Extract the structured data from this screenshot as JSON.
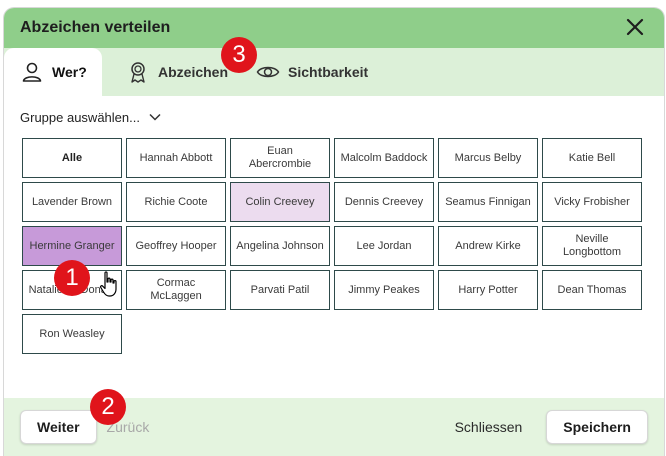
{
  "modal": {
    "title": "Abzeichen verteilen"
  },
  "tabs": [
    {
      "label": "Wer?",
      "icon": "person-icon",
      "active": true
    },
    {
      "label": "Abzeichen",
      "icon": "award-icon",
      "active": false
    },
    {
      "label": "Sichtbarkeit",
      "icon": "eye-icon",
      "active": false
    }
  ],
  "group_select": {
    "label": "Gruppe auswählen..."
  },
  "students": [
    {
      "name": "Alle",
      "state": "bold"
    },
    {
      "name": "Hannah Abbott",
      "state": "normal"
    },
    {
      "name": "Euan Abercrombie",
      "state": "normal"
    },
    {
      "name": "Malcolm Baddock",
      "state": "normal"
    },
    {
      "name": "Marcus Belby",
      "state": "normal"
    },
    {
      "name": "Katie Bell",
      "state": "normal"
    },
    {
      "name": "Lavender Brown",
      "state": "normal"
    },
    {
      "name": "Richie Coote",
      "state": "normal"
    },
    {
      "name": "Colin Creevey",
      "state": "light"
    },
    {
      "name": "Dennis Creevey",
      "state": "normal"
    },
    {
      "name": "Seamus Finnigan",
      "state": "normal"
    },
    {
      "name": "Vicky Frobisher",
      "state": "normal"
    },
    {
      "name": "Hermine Granger",
      "state": "strong"
    },
    {
      "name": "Geoffrey Hooper",
      "state": "normal"
    },
    {
      "name": "Angelina Johnson",
      "state": "normal"
    },
    {
      "name": "Lee Jordan",
      "state": "normal"
    },
    {
      "name": "Andrew Kirke",
      "state": "normal"
    },
    {
      "name": "Neville Longbottom",
      "state": "normal"
    },
    {
      "name": "Natalie McDonald",
      "state": "normal"
    },
    {
      "name": "Cormac McLaggen",
      "state": "normal"
    },
    {
      "name": "Parvati Patil",
      "state": "normal"
    },
    {
      "name": "Jimmy Peakes",
      "state": "normal"
    },
    {
      "name": "Harry Potter",
      "state": "normal"
    },
    {
      "name": "Dean Thomas",
      "state": "normal"
    },
    {
      "name": "Ron Weasley",
      "state": "normal"
    }
  ],
  "footer": {
    "next_label": "Weiter",
    "back_label": "Zurück",
    "close_label": "Schliessen",
    "save_label": "Speichern"
  },
  "markers": [
    "1",
    "2",
    "3"
  ],
  "colors": {
    "header_green": "#8fce8a",
    "tab_bar_green": "#dcf0d8",
    "footer_green": "#e4f4df",
    "selected_strong": "#c79ad9",
    "selected_light": "#ecdcef",
    "marker_red": "#e0141b"
  }
}
